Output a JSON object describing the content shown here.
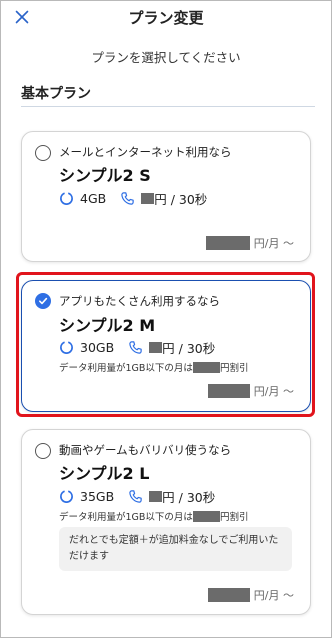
{
  "header": {
    "title": "プラン変更",
    "close_icon": "close-icon"
  },
  "subtitle": "プランを選択してください",
  "section": {
    "title": "基本プラン"
  },
  "plans": [
    {
      "lead": "メールとインターネット利用なら",
      "name": "シンプル2 S",
      "data_amount": "4GB",
      "call_rate_suffix": "円 / 30秒",
      "price_unit": "円/月 〜",
      "selected": false
    },
    {
      "lead": "アプリもたくさん利用するなら",
      "name": "シンプル2 M",
      "data_amount": "30GB",
      "call_rate_suffix": "円 / 30秒",
      "discount_note_prefix": "データ利用量が1GB以下の月は",
      "discount_note_suffix": "円割引",
      "price_unit": "円/月 〜",
      "selected": true
    },
    {
      "lead": "動画やゲームもバリバリ使うなら",
      "name": "シンプル2 L",
      "data_amount": "35GB",
      "call_rate_suffix": "円 / 30秒",
      "discount_note_prefix": "データ利用量が1GB以下の月は",
      "discount_note_suffix": "円割引",
      "info": "だれとでも定額＋が追加料金なしでご利用いただけます",
      "price_unit": "円/月 〜",
      "selected": false
    }
  ],
  "colors": {
    "accent": "#2f6fe4",
    "selected_border": "#1a4fb0",
    "highlight_outline": "#e1141c",
    "redaction": "#6b6b6b"
  }
}
